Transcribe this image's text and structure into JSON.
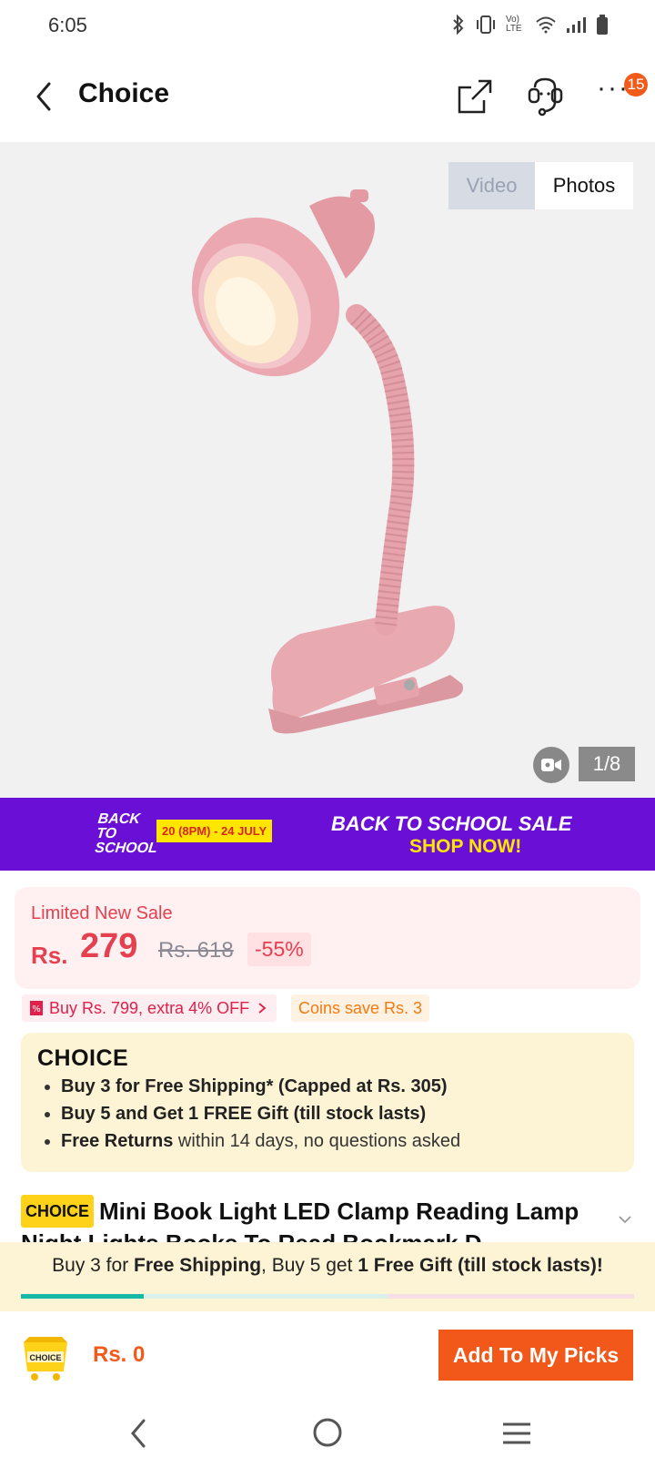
{
  "status_bar": {
    "time": "6:05",
    "icons": [
      "bluetooth-icon",
      "vibrate-icon",
      "volte-icon",
      "wifi-icon",
      "signal-icon",
      "battery-icon"
    ],
    "volte_text": "Vo) LTE"
  },
  "header": {
    "title": "Choice",
    "badge_count": "15",
    "more_label": "···"
  },
  "gallery": {
    "tab_video": "Video",
    "tab_photos": "Photos",
    "counter": "1/8",
    "active_tab": "Photos"
  },
  "banner": {
    "back_to_school": "BACK TO SCHOOL",
    "date": "20 (8PM) - 24 JULY",
    "sale": "BACK TO SCHOOL SALE",
    "shop_now": "SHOP NOW!",
    "colors": {
      "bg": "#6a10d6",
      "accent": "#ffe600"
    }
  },
  "price": {
    "label": "Limited New Sale",
    "currency": "Rs.",
    "amount": "279",
    "original": "Rs. 618",
    "discount": "-55%"
  },
  "coupons": {
    "extra": "Buy Rs. 799, extra 4% OFF",
    "coins": "Coins save Rs. 3"
  },
  "choice_card": {
    "logo": "CHOICE",
    "b1_bold": "Buy 3 for  Free Shipping* (Capped at Rs. 305)",
    "b2_bold": "Buy 5 and Get 1 FREE Gift (till stock lasts)",
    "b3_bold": "Free Returns",
    "b3_rest": " within 14 days, no questions asked"
  },
  "product": {
    "pill": "CHOICE",
    "title": "Mini Book Light LED Clamp Reading Lamp Night Lights Books To Read Bookmark D..."
  },
  "shipping_bar": {
    "p1": "Buy 3 for ",
    "p2": "Free Shipping",
    "p3": ", Buy 5 get ",
    "p4": "1 Free Gift (till stock lasts)!",
    "progress": 0.2
  },
  "action": {
    "cart_label": "CHOICE",
    "total": "Rs. 0",
    "button": "Add To My Picks"
  }
}
